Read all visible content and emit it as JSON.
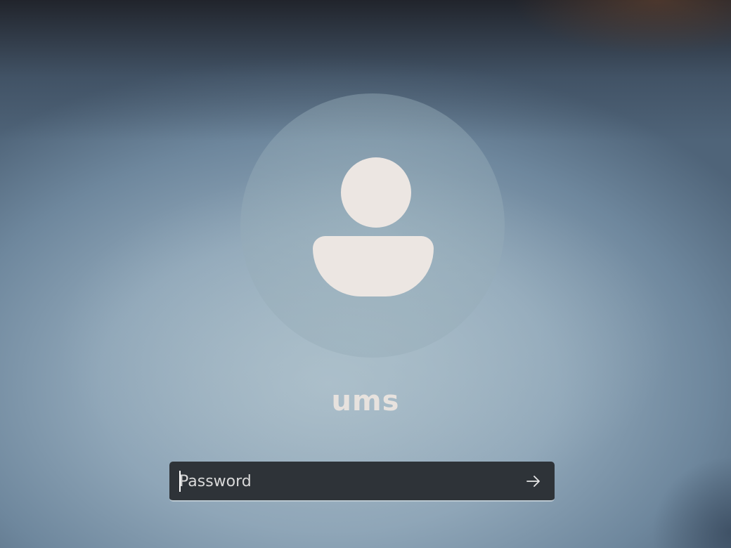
{
  "login": {
    "username": "ums",
    "password": {
      "value": "",
      "placeholder": "Password"
    },
    "submit_icon": "arrow-right-icon"
  },
  "colors": {
    "avatar_glyph": "#ece6e2",
    "password_field_bg": "#2e3338",
    "username_text": "#e7e2de"
  }
}
